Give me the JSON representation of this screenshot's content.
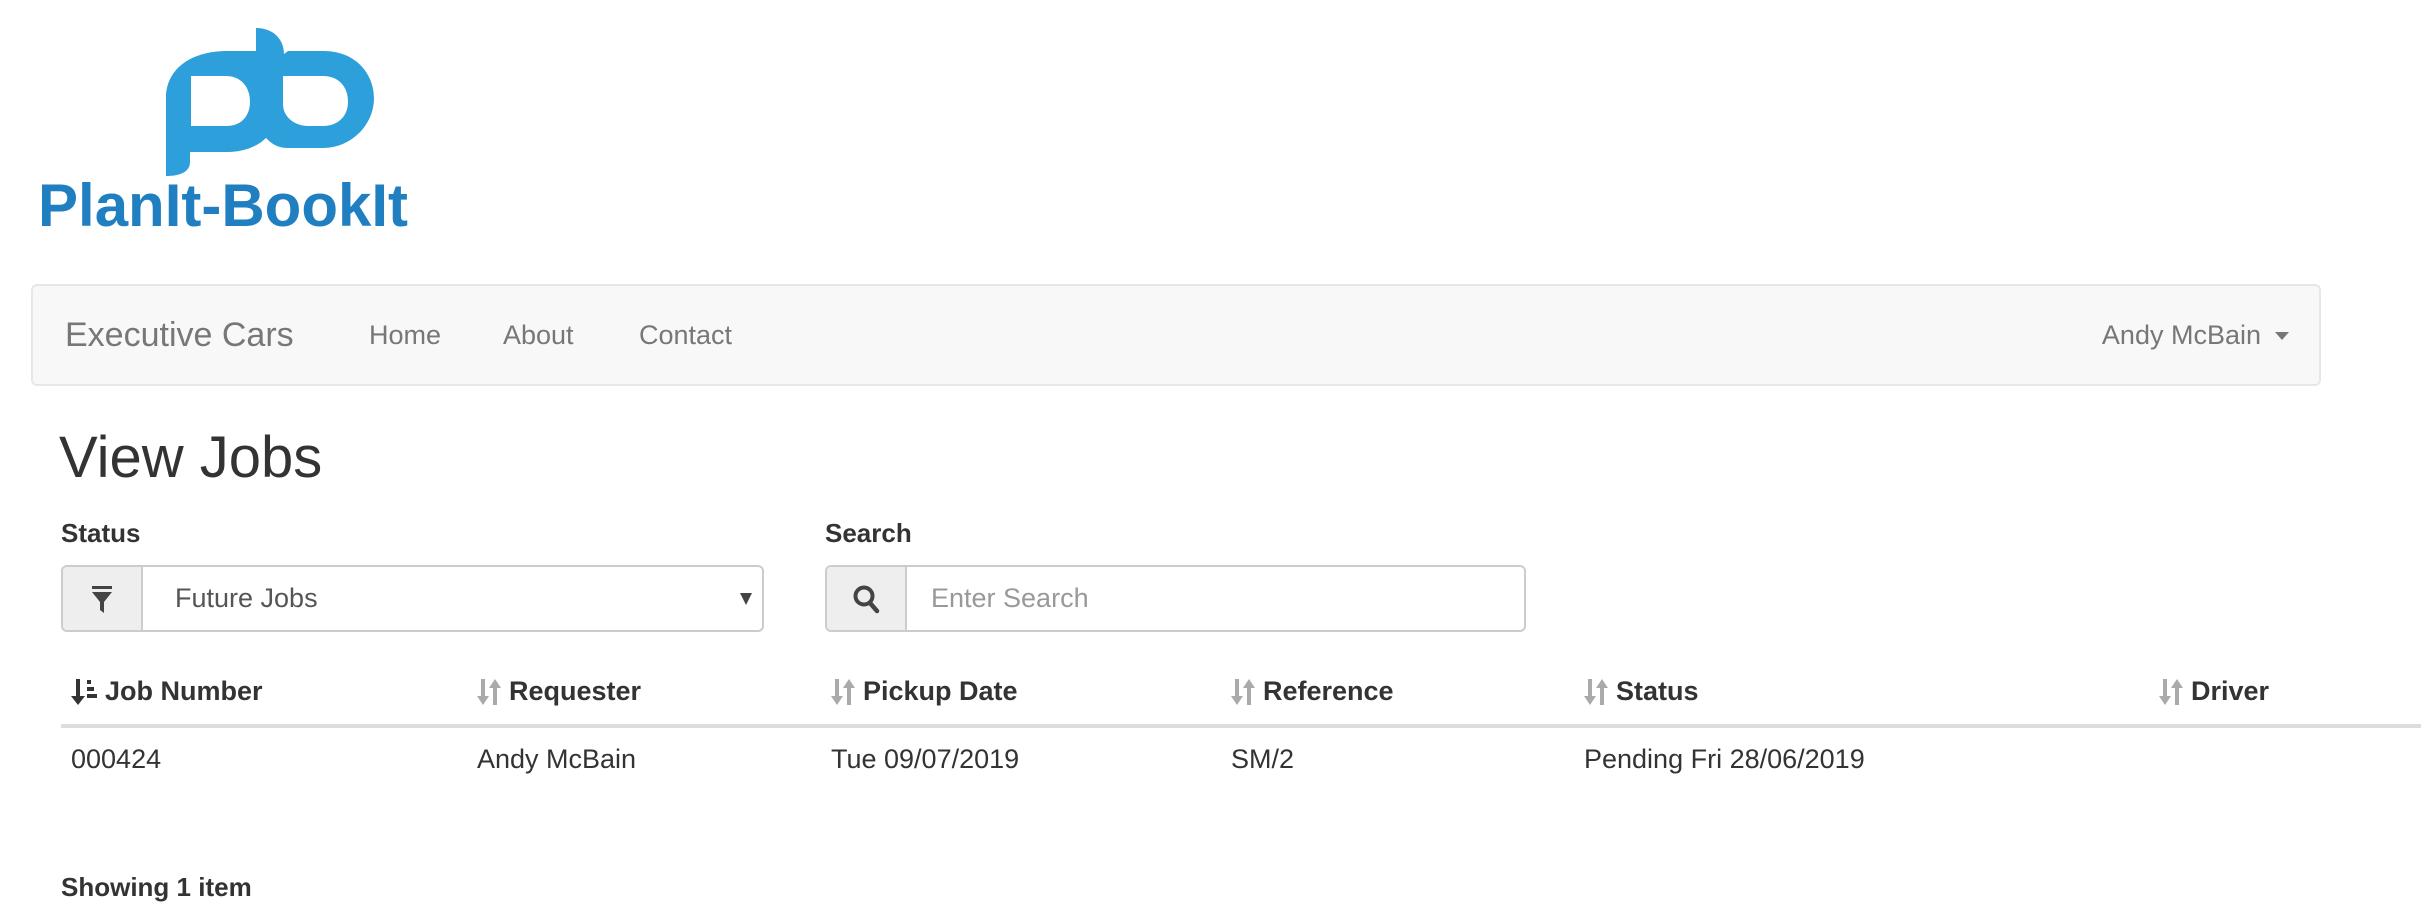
{
  "logo": {
    "monogram": "pb",
    "text": "PlanIt-BookIt",
    "color_light": "#2d9fda",
    "color_dark": "#1f7fc1"
  },
  "navbar": {
    "brand": "Executive Cars",
    "links": [
      {
        "label": "Home"
      },
      {
        "label": "About"
      },
      {
        "label": "Contact"
      }
    ],
    "user": {
      "name": "Andy McBain",
      "icon": "caret-down-icon"
    }
  },
  "page": {
    "title": "View Jobs"
  },
  "filters": {
    "status": {
      "label": "Status",
      "icon": "filter-icon",
      "selected": "Future Jobs"
    },
    "search": {
      "label": "Search",
      "icon": "search-icon",
      "value": "",
      "placeholder": "Enter Search"
    }
  },
  "table": {
    "columns": [
      {
        "label": "Job Number",
        "sort": "ascending",
        "icon": "sort-ascending-icon"
      },
      {
        "label": "Requester",
        "sort": "none",
        "icon": "sort-icon"
      },
      {
        "label": "Pickup Date",
        "sort": "none",
        "icon": "sort-icon"
      },
      {
        "label": "Reference",
        "sort": "none",
        "icon": "sort-icon"
      },
      {
        "label": "Status",
        "sort": "none",
        "icon": "sort-icon"
      },
      {
        "label": "Driver",
        "sort": "none",
        "icon": "sort-icon"
      }
    ],
    "rows": [
      {
        "job_number": "000424",
        "requester": "Andy McBain",
        "pickup_date": "Tue 09/07/2019",
        "reference": "SM/2",
        "status": "Pending Fri 28/06/2019",
        "driver": ""
      }
    ]
  },
  "footer": {
    "count_text": "Showing 1 item"
  }
}
